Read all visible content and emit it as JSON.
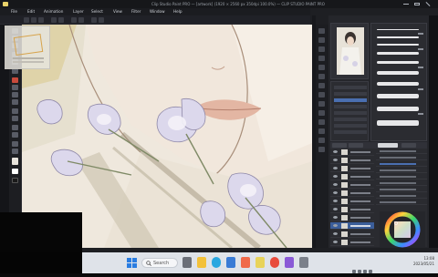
{
  "window": {
    "title": "Clip Studio Paint PRO — [artwork] (1920 × 2560 px 350dpi 100.0%) — CLIP STUDIO PAINT PRO"
  },
  "menu": {
    "items": [
      "File",
      "Edit",
      "Animation",
      "Layer",
      "Select",
      "View",
      "Filter",
      "Window",
      "Help"
    ]
  },
  "taskbar": {
    "search_placeholder": "Search",
    "time": "13:08",
    "date": "2023/05/21"
  },
  "colors": {
    "accent": "#3b5e9a",
    "active_tool": "#c84a3c",
    "canvas_skin": "#ece4d8",
    "flower": "#d8d4ea"
  },
  "icons": {
    "tools": [
      "move-icon",
      "zoom-icon",
      "hand-icon",
      "select-icon",
      "lasso-icon",
      "eyedropper-icon",
      "pen-icon",
      "pencil-icon",
      "brush-icon",
      "airbrush-icon",
      "eraser-icon",
      "fill-icon",
      "gradient-icon",
      "shape-icon",
      "text-icon",
      "blend-icon"
    ],
    "taskbar": [
      "start-icon",
      "search-icon",
      "task-view-icon",
      "explorer-icon",
      "edge-icon",
      "store-icon",
      "mail-icon",
      "clip-studio-icon",
      "chrome-icon",
      "photos-icon",
      "settings-icon"
    ]
  }
}
